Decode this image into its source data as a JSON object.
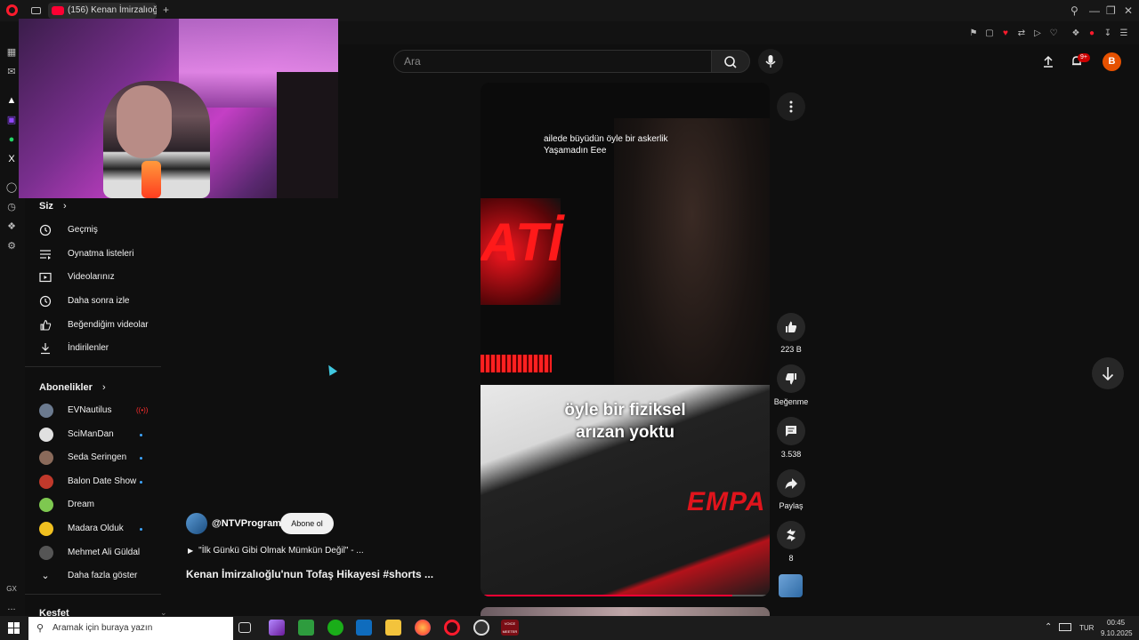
{
  "browser": {
    "tab_title": "(156) Kenan İmirzalıoğ",
    "new_tab": "+",
    "sidebar_bottom_label": "GX",
    "sidebar_more": "..."
  },
  "youtube": {
    "search_placeholder": "Ara",
    "notification_badge": "9+",
    "avatar_letter": "B"
  },
  "guide": {
    "you_header": "Siz",
    "you_items": [
      {
        "label": "Geçmiş",
        "icon": "history-icon"
      },
      {
        "label": "Oynatma listeleri",
        "icon": "playlists-icon"
      },
      {
        "label": "Videolarınız",
        "icon": "your-videos-icon"
      },
      {
        "label": "Daha sonra izle",
        "icon": "watch-later-icon"
      },
      {
        "label": "Beğendiğim videolar",
        "icon": "liked-videos-icon"
      },
      {
        "label": "İndirilenler",
        "icon": "downloads-icon"
      }
    ],
    "subs_header": "Abonelikler",
    "subs": [
      {
        "label": "EVNautilus",
        "color": "#6b7a8f",
        "live": true
      },
      {
        "label": "SciManDan",
        "color": "#e0e0e0"
      },
      {
        "label": "Seda Seringen",
        "color": "#8a6a5a"
      },
      {
        "label": "Balon Date Show",
        "color": "#c0392b"
      },
      {
        "label": "Dream",
        "color": "#7ec850"
      },
      {
        "label": "Madara Olduk",
        "color": "#f0c020"
      },
      {
        "label": "Mehmet Ali Güldal",
        "color": "#555555"
      }
    ],
    "show_more": "Daha fazla göster",
    "explore_header": "Keşfet"
  },
  "short": {
    "subtitle_top_line1": "ailede büyüdün öyle bir askerlik",
    "subtitle_top_line2": "Yaşamadın Eee",
    "subtitle_big_line1": "öyle bir fiziksel",
    "subtitle_big_line2": "arızan yoktu",
    "bg_text_1": "ATİ",
    "bg_text_2": "EMPA",
    "progress": 0.87
  },
  "actions": {
    "likes": "223 B",
    "dislike_label": "Beğenme",
    "comments": "3.538",
    "share_label": "Paylaş",
    "remix_count": "8"
  },
  "channel": {
    "name": "@NTVProgram",
    "subscribe_label": "Abone ol",
    "playlist_text": "\"İlk Günkü Gibi Olmak Mümkün Değil\" - ...",
    "video_title": "Kenan İmirzalıoğlu'nun Tofaş Hikayesi #shorts ..."
  },
  "taskbar": {
    "search_placeholder": "Aramak için buraya yazın",
    "language": "TUR",
    "time": "00:45",
    "date": "9.10.2025",
    "voice_label": "VOICE MEETER"
  }
}
